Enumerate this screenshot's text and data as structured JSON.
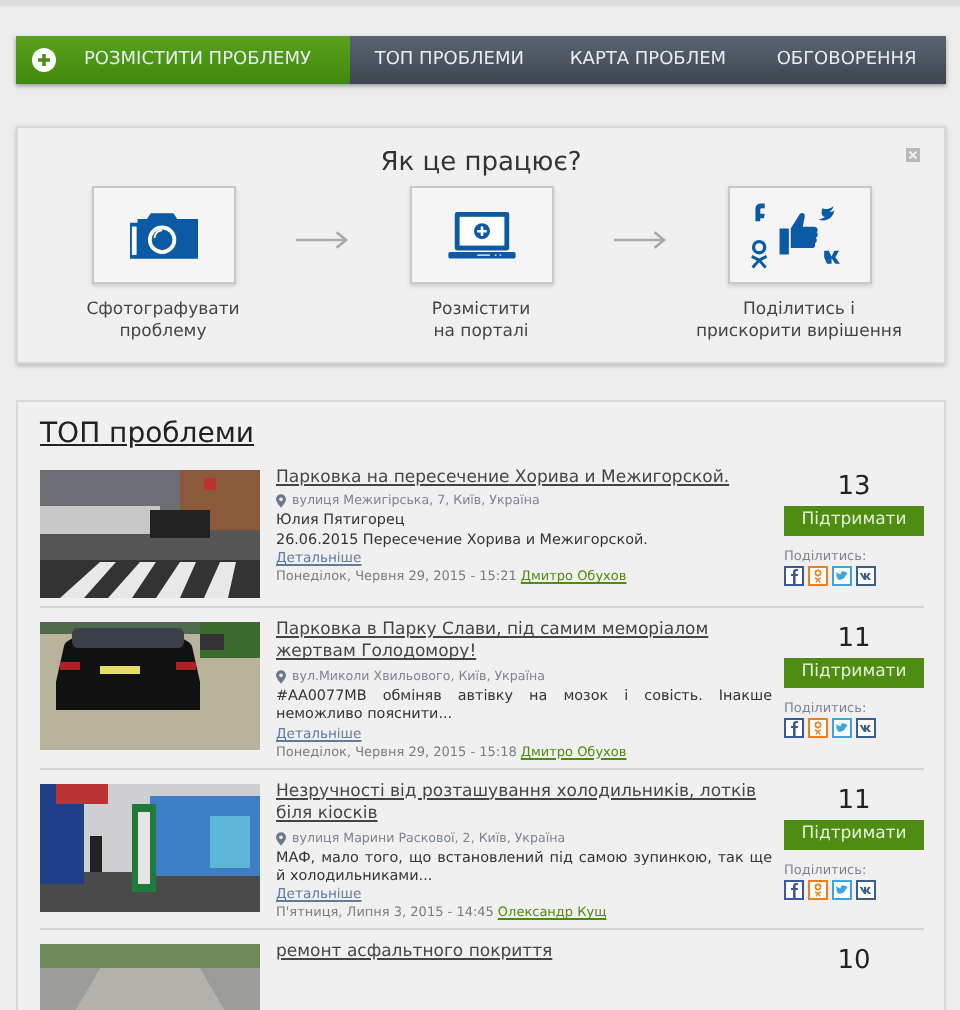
{
  "nav": [
    {
      "label": "РОЗМІСТИТИ ПРОБЛЕМУ",
      "kind": "add",
      "selected": true
    },
    {
      "label": "ТОП ПРОБЛЕМИ",
      "kind": "link",
      "selected": false
    },
    {
      "label": "КАРТА ПРОБЛЕМ",
      "kind": "link",
      "selected": false
    },
    {
      "label": "ОБГОВОРЕННЯ",
      "kind": "link",
      "selected": false
    }
  ],
  "how_it_works": {
    "title": "Як це працює?",
    "steps": [
      {
        "kind": "camera",
        "label": "Сфотографувати\nпроблему"
      },
      {
        "kind": "laptop",
        "label": "Розмістити\nна порталі"
      },
      {
        "kind": "social",
        "label": "Поділитись і\nприскорити вирішення"
      }
    ]
  },
  "top": {
    "title": "ТОП проблеми",
    "rows": [
      {
        "title": "Парковка на пересечение Хорива и Межигорской.",
        "address": "вулиця Межигірська, 7, Київ, Україна",
        "text": "Юлия Пятигорец\n26.06.2015 Пересечение Хорива и Межигорской.",
        "details": "Детальніше",
        "date": "Понеділок, Червня 29, 2015 - 15:21",
        "author": "Дмитро Обухов",
        "count": "13",
        "support": "Підтримати",
        "share": "Поділитись:"
      },
      {
        "title": "Парковка в Парку Слави, під самим меморіалом жертвам Голодомору!",
        "address": "вул.Миколи Хвильового, Київ, Україна",
        "text": "#АА0077МВ обміняв автівку на мозок і совість. Інакше неможливо пояснити...",
        "details": "Детальніше",
        "date": "Понеділок, Червня 29, 2015 - 15:18",
        "author": "Дмитро Обухов",
        "count": "11",
        "support": "Підтримати",
        "share": "Поділитись:"
      },
      {
        "title": "Незручності від розташування холодильників, лотків біля кіосків",
        "address": "вулиця Марини Раскової, 2, Київ, Україна",
        "text": "МАФ, мало того, що встановлений під самою зупинкою, так ще й холодильниками...",
        "details": "Детальніше",
        "date": "П'ятниця, Липня 3, 2015 - 14:45",
        "author": "Олександр Кущ",
        "count": "11",
        "support": "Підтримати",
        "share": "Поділитись:"
      },
      {
        "title": "ремонт асфальтного покриття",
        "count": "10"
      }
    ]
  }
}
